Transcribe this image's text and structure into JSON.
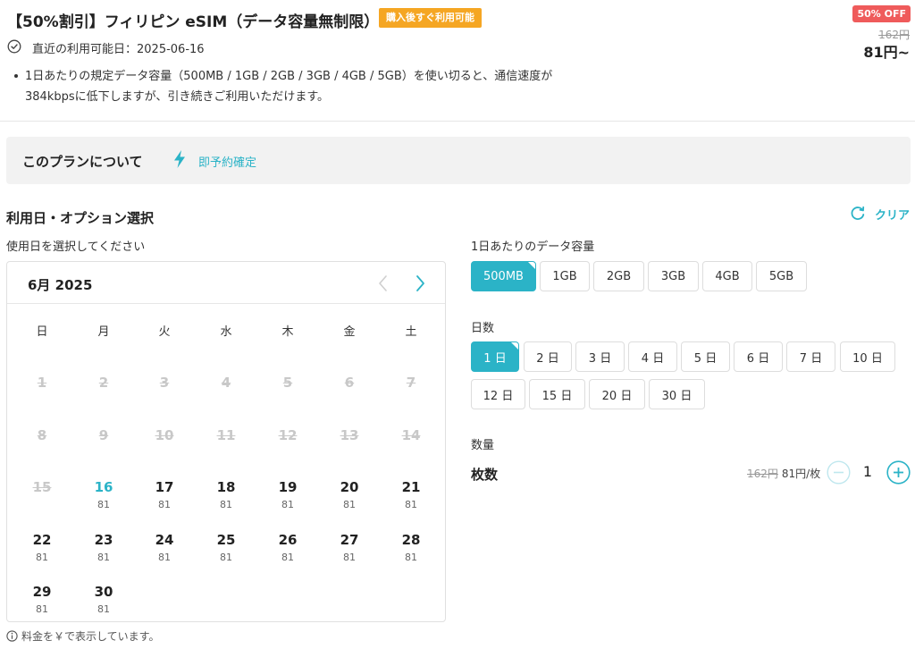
{
  "product": {
    "title": "【50%割引】フィリピン eSIM（データ容量無制限）",
    "instant_badge": "購入後すぐ利用可能",
    "discount_badge": "50% OFF",
    "original_price": "162円",
    "price": "81円~",
    "availability_label": "直近の利用可能日：2025-06-16",
    "note_line1": "1日あたりの規定データ容量（500MB / 1GB / 2GB / 3GB / 4GB / 5GB）を使い切ると、通信速度が",
    "note_line2": "384kbpsに低下しますが、引き続きご利用いただけます。"
  },
  "about": {
    "title": "このプランについて",
    "instant_confirm": "即予約確定"
  },
  "selection": {
    "title": "利用日・オプション選択",
    "clear_label": "クリア",
    "date_label": "使用日を選択してください",
    "fee_note": "料金を￥で表示しています。"
  },
  "calendar": {
    "month_label": "6月 2025",
    "weekdays": [
      "日",
      "月",
      "火",
      "水",
      "木",
      "金",
      "土"
    ],
    "first_weekday_index": 0,
    "days": [
      {
        "d": "1",
        "disabled": true
      },
      {
        "d": "2",
        "disabled": true
      },
      {
        "d": "3",
        "disabled": true
      },
      {
        "d": "4",
        "disabled": true
      },
      {
        "d": "5",
        "disabled": true
      },
      {
        "d": "6",
        "disabled": true
      },
      {
        "d": "7",
        "disabled": true
      },
      {
        "d": "8",
        "disabled": true
      },
      {
        "d": "9",
        "disabled": true
      },
      {
        "d": "10",
        "disabled": true
      },
      {
        "d": "11",
        "disabled": true
      },
      {
        "d": "12",
        "disabled": true
      },
      {
        "d": "13",
        "disabled": true
      },
      {
        "d": "14",
        "disabled": true
      },
      {
        "d": "15",
        "disabled": true
      },
      {
        "d": "16",
        "price": "81",
        "today": true
      },
      {
        "d": "17",
        "price": "81"
      },
      {
        "d": "18",
        "price": "81"
      },
      {
        "d": "19",
        "price": "81"
      },
      {
        "d": "20",
        "price": "81"
      },
      {
        "d": "21",
        "price": "81"
      },
      {
        "d": "22",
        "price": "81"
      },
      {
        "d": "23",
        "price": "81"
      },
      {
        "d": "24",
        "price": "81"
      },
      {
        "d": "25",
        "price": "81"
      },
      {
        "d": "26",
        "price": "81"
      },
      {
        "d": "27",
        "price": "81"
      },
      {
        "d": "28",
        "price": "81"
      },
      {
        "d": "29",
        "price": "81"
      },
      {
        "d": "30",
        "price": "81"
      }
    ]
  },
  "data_capacity": {
    "label": "1日あたりのデータ容量",
    "options": [
      "500MB",
      "1GB",
      "2GB",
      "3GB",
      "4GB",
      "5GB"
    ],
    "selected": "500MB"
  },
  "days_option": {
    "label": "日数",
    "options": [
      "1 日",
      "2 日",
      "3 日",
      "4 日",
      "5 日",
      "6 日",
      "7 日",
      "10 日",
      "12 日",
      "15 日",
      "20 日",
      "30 日"
    ],
    "selected": "1 日"
  },
  "quantity": {
    "section_label": "数量",
    "label": "枚数",
    "original_unit_price": "162円",
    "unit_price": "81円/枚",
    "value": "1"
  },
  "colors": {
    "accent": "#2bb3c7",
    "badge_orange": "#f5a623",
    "badge_red": "#ef5b5b"
  }
}
